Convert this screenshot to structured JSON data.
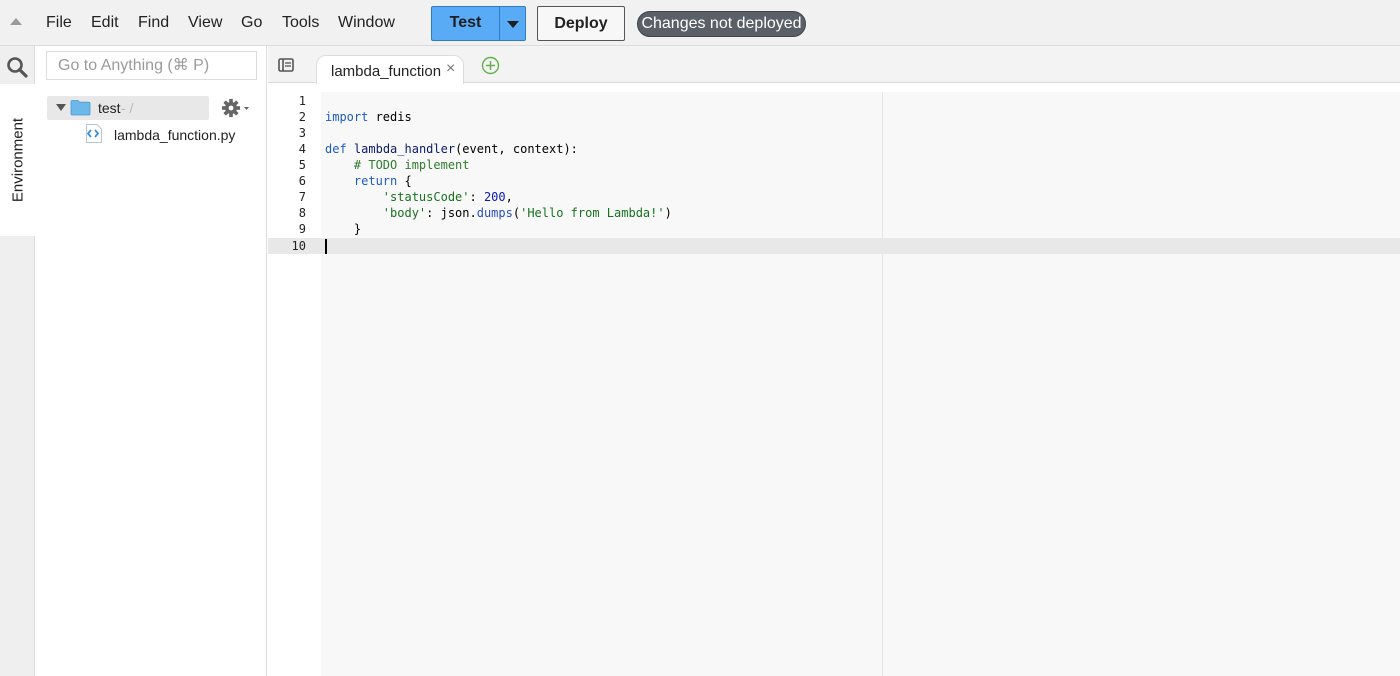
{
  "menubar": {
    "items": [
      "File",
      "Edit",
      "Find",
      "View",
      "Go",
      "Tools",
      "Window"
    ],
    "test_label": "Test",
    "deploy_label": "Deploy",
    "status_badge": "Changes not deployed"
  },
  "sidebar": {
    "vertical_tab": "Environment",
    "goto_placeholder": "Go to Anything (⌘ P)",
    "root_folder": {
      "name": "test",
      "path": "- /"
    },
    "files": [
      "lambda_function.py"
    ]
  },
  "editor": {
    "tabs": [
      {
        "label": "lambda_function",
        "active": true
      }
    ],
    "line_numbers": [
      "1",
      "2",
      "3",
      "4",
      "5",
      "6",
      "7",
      "8",
      "9",
      "10"
    ],
    "cursor_line": 10,
    "code": {
      "l2_kw": "import",
      "l2_rest": " redis",
      "l4_kw": "def",
      "l4_fn": "lambda_handler",
      "l4_rest": "(event, context):",
      "l5_comment": "# TODO implement",
      "l6_kw": "return",
      "l6_rest": " {",
      "l7_str": "'statusCode'",
      "l7_colon": ": ",
      "l7_num": "200",
      "l7_end": ",",
      "l8_str": "'body'",
      "l8_mid": ": json.",
      "l8_fn": "dumps",
      "l8_open": "(",
      "l8_arg": "'Hello from Lambda!'",
      "l8_close": ")",
      "l9": "}"
    }
  },
  "colors": {
    "test_button": "#5aabf6",
    "badge_bg": "#5b5f66",
    "keyword": "#1c5dbd",
    "string": "#17721f",
    "number": "#0a1ab0",
    "comment": "#2f7d2f",
    "add_tab": "#62b14d",
    "folder": "#6cb8ea"
  },
  "icons": [
    "collapse-arrow-icon",
    "search-icon",
    "folder-icon",
    "python-file-icon",
    "gear-icon",
    "tab-list-icon",
    "add-tab-icon",
    "close-icon",
    "dropdown-arrow-icon"
  ]
}
